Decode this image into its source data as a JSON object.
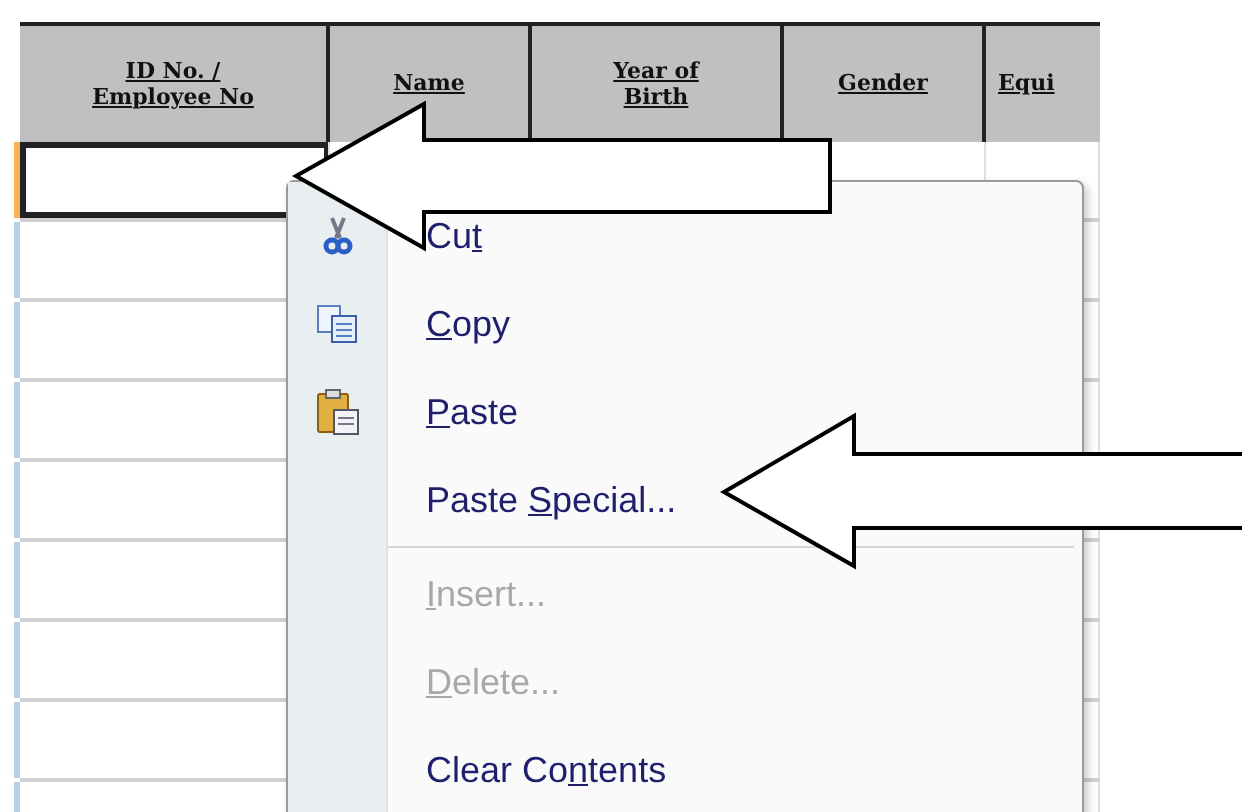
{
  "table": {
    "columns": [
      {
        "lines": [
          "ID No. /",
          "Employee No"
        ]
      },
      {
        "lines": [
          "Name"
        ]
      },
      {
        "lines": [
          "Year of",
          "Birth"
        ]
      },
      {
        "lines": [
          "Gender"
        ]
      },
      {
        "lines": [
          "Equi"
        ]
      }
    ],
    "rows": [
      {
        "selected": true
      },
      {
        "selected": false
      },
      {
        "selected": false
      },
      {
        "selected": false
      },
      {
        "selected": false
      },
      {
        "selected": false
      },
      {
        "selected": false
      },
      {
        "selected": false
      },
      {
        "selected": false
      }
    ]
  },
  "context_menu": {
    "items": [
      {
        "kind": "item",
        "disabled": false,
        "label": [
          {
            "text": "Cu",
            "underline": false
          },
          {
            "text": "t",
            "underline": true
          }
        ]
      },
      {
        "kind": "item",
        "disabled": false,
        "label": [
          {
            "text": "C",
            "underline": true
          },
          {
            "text": "opy",
            "underline": false
          }
        ]
      },
      {
        "kind": "item",
        "disabled": false,
        "label": [
          {
            "text": "P",
            "underline": true
          },
          {
            "text": "aste",
            "underline": false
          }
        ]
      },
      {
        "kind": "item",
        "disabled": false,
        "label": [
          {
            "text": "Paste ",
            "underline": false
          },
          {
            "text": "S",
            "underline": true
          },
          {
            "text": "pecial...",
            "underline": false
          }
        ]
      },
      {
        "kind": "separator"
      },
      {
        "kind": "item",
        "disabled": true,
        "label": [
          {
            "text": "I",
            "underline": true
          },
          {
            "text": "nsert...",
            "underline": false
          }
        ]
      },
      {
        "kind": "item",
        "disabled": true,
        "label": [
          {
            "text": "D",
            "underline": true
          },
          {
            "text": "elete...",
            "underline": false
          }
        ]
      },
      {
        "kind": "item",
        "disabled": false,
        "label": [
          {
            "text": "Clear Co",
            "underline": false
          },
          {
            "text": "n",
            "underline": true
          },
          {
            "text": "tents",
            "underline": false
          }
        ]
      }
    ]
  }
}
